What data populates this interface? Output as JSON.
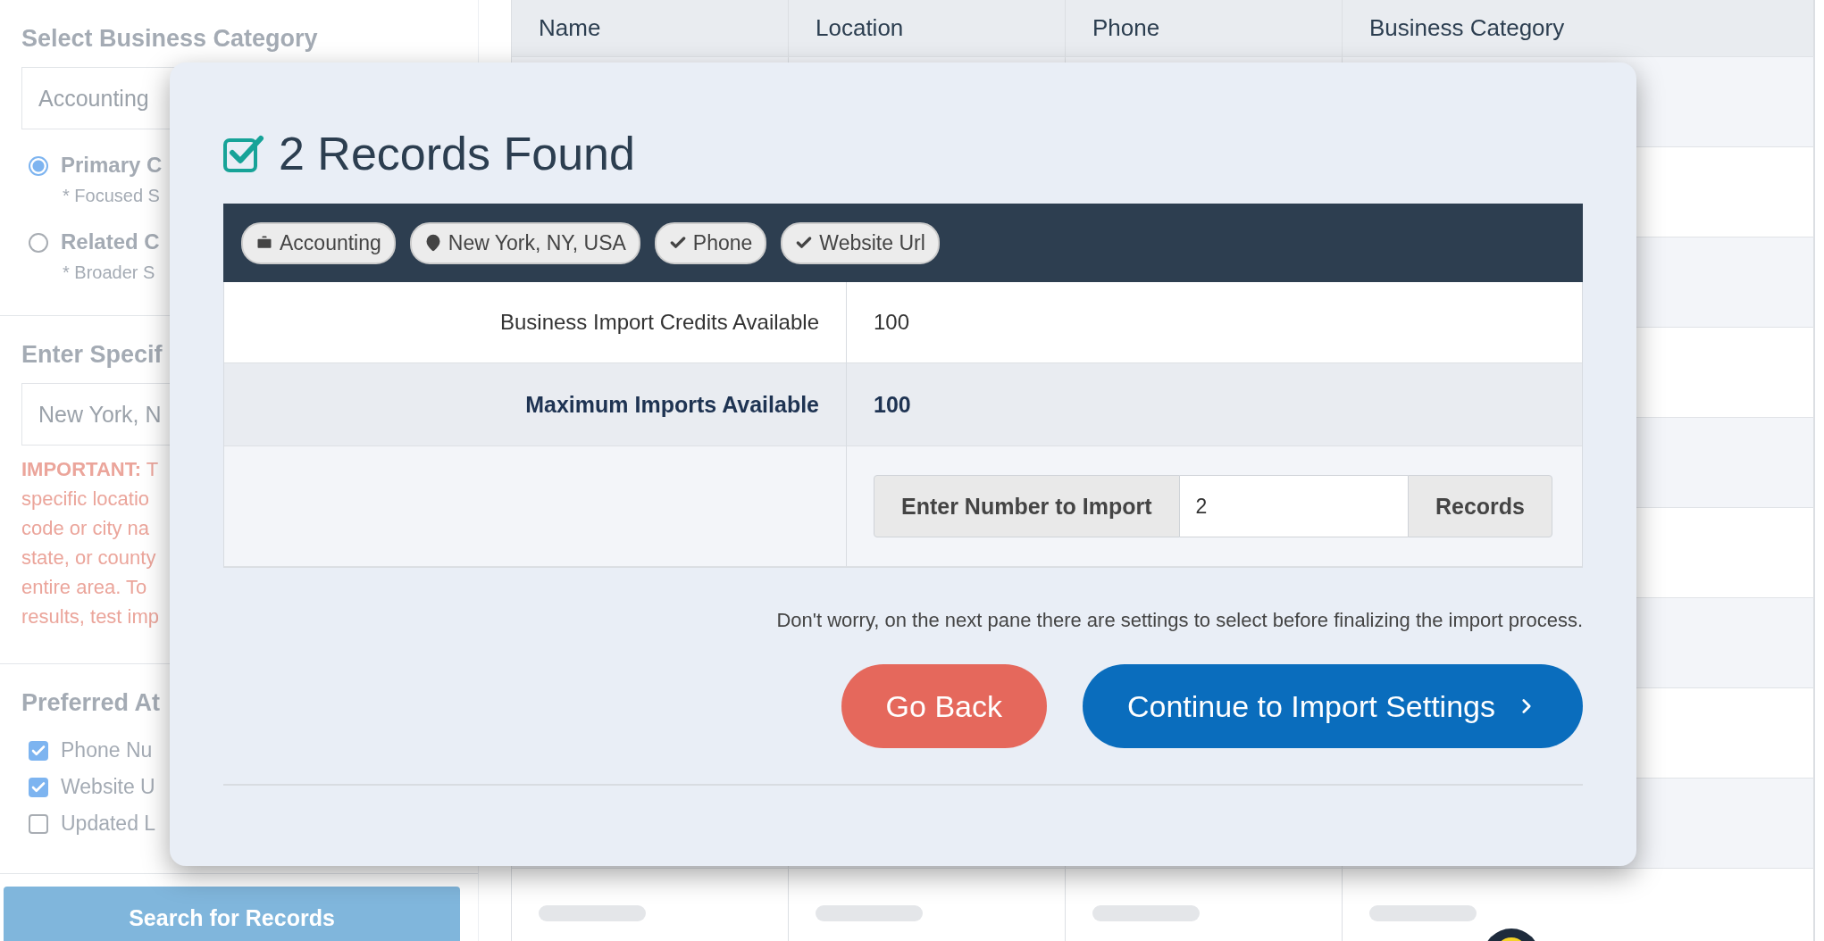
{
  "sidebar": {
    "category_section": {
      "title": "Select Business Category",
      "select_value": "Accounting",
      "options": [
        {
          "label": "Primary C",
          "hint": "* Focused S",
          "selected": true
        },
        {
          "label": "Related C",
          "hint": "* Broader S",
          "selected": false
        }
      ]
    },
    "location_section": {
      "title": "Enter Specif",
      "value": "New York, N",
      "notice_lines": [
        "**IMPORTANT:** T",
        "specific locatio",
        "code or city na",
        "state, or county",
        "entire area. To",
        "results, test imp"
      ]
    },
    "attributes_section": {
      "title": "Preferred At",
      "items": [
        {
          "label": "Phone Nu",
          "checked": true
        },
        {
          "label": "Website U",
          "checked": true
        },
        {
          "label": "Updated L",
          "checked": false
        }
      ]
    },
    "search_button": "Search for Records"
  },
  "table": {
    "columns": [
      "Name",
      "Location",
      "Phone",
      "Business Category"
    ]
  },
  "modal": {
    "title": "2 Records Found",
    "filters": [
      {
        "kind": "category",
        "label": "Accounting"
      },
      {
        "kind": "location",
        "label": "New York, NY, USA"
      },
      {
        "kind": "attribute",
        "label": "Phone"
      },
      {
        "kind": "attribute",
        "label": "Website Url"
      }
    ],
    "stats": [
      {
        "label": "Business Import Credits Available",
        "value": "100",
        "emphasis": false
      },
      {
        "label": "Maximum Imports Available",
        "value": "100",
        "emphasis": true
      }
    ],
    "import_input": {
      "prefix": "Enter Number to Import",
      "value": "2",
      "suffix": "Records"
    },
    "note": "Don't worry, on the next pane there are settings to select before finalizing the import process.",
    "buttons": [
      {
        "kind": "back",
        "label": "Go Back"
      },
      {
        "kind": "primary",
        "label": "Continue to Import Settings"
      }
    ]
  }
}
